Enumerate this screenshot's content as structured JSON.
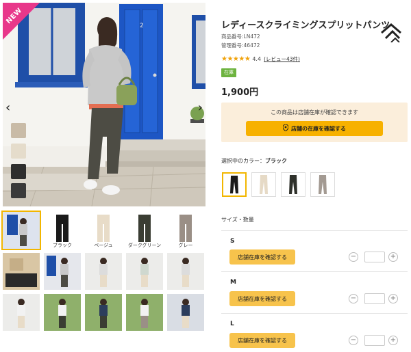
{
  "gallery": {
    "badge": "NEW",
    "prev_arrow": "‹",
    "next_arrow": "›",
    "door_number": "2",
    "color_swatches": [
      "#c9bba7",
      "#e5dccb",
      "#2e2e2e",
      "#3a3a3a"
    ],
    "thumb_captions": [
      "",
      "ブラック",
      "ベージュ",
      "ダークグリーン",
      "グレー"
    ]
  },
  "product": {
    "title": "レディースクライミングスプリットパンツ",
    "item_number": "商品番号:LN472",
    "management_number": "管理番号:46472",
    "stars": "★★★★★",
    "rating": "4.4",
    "reviews": "(レビュー43件)",
    "tag": "在庫",
    "price": "1,900円"
  },
  "stock": {
    "note": "この商品は店舗在庫が確認できます",
    "button_label": "店舗の在庫を確認する"
  },
  "color": {
    "label_prefix": "選択中のカラー：",
    "selected": "ブラック",
    "options": [
      "black-pants-icon",
      "beige-pants-icon",
      "darkgreen-pants-icon",
      "gray-pants-icon"
    ]
  },
  "sizes": {
    "label": "サイズ・数量",
    "items": [
      {
        "name": "S",
        "button_label": "店舗在庫を確認する",
        "qty": ""
      },
      {
        "name": "M",
        "button_label": "店舗在庫を確認する",
        "qty": ""
      },
      {
        "name": "L",
        "button_label": "店舗在庫を確認する",
        "qty": ""
      }
    ],
    "minus": "−",
    "plus": "+"
  },
  "colors": {
    "accent": "#f7b100",
    "accent_light": "#f7c34c",
    "badge": "#e8378a",
    "stock_bg": "#fbeedb",
    "tag": "#6db33f",
    "door": "#1f4fa8"
  }
}
